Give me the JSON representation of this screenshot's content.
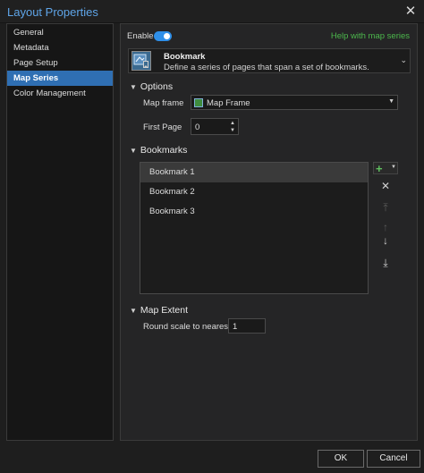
{
  "window": {
    "title": "Layout Properties",
    "close_glyph": "✕"
  },
  "nav": {
    "items": [
      {
        "label": "General",
        "active": false
      },
      {
        "label": "Metadata",
        "active": false
      },
      {
        "label": "Page Setup",
        "active": false
      },
      {
        "label": "Map Series",
        "active": true
      },
      {
        "label": "Color Management",
        "active": false
      }
    ]
  },
  "map_series": {
    "enable_label": "Enable",
    "enabled": true,
    "help_link": "Help with map series",
    "type": {
      "name": "Bookmark",
      "description": "Define a series of pages that span a set of bookmarks.",
      "icon": "bookmark-map-icon"
    },
    "options": {
      "header": "Options",
      "map_frame_label": "Map frame",
      "map_frame_value": "Map Frame",
      "first_page_label": "First Page",
      "first_page_value": "0"
    },
    "bookmarks": {
      "header": "Bookmarks",
      "items": [
        "Bookmark 1",
        "Bookmark 2",
        "Bookmark 3"
      ],
      "selected_index": 0
    },
    "map_extent": {
      "header": "Map Extent",
      "round_scale_label": "Round scale to nearest",
      "round_scale_value": "1"
    }
  },
  "footer": {
    "ok_label": "OK",
    "cancel_label": "Cancel"
  },
  "colors": {
    "accent": "#2f6fb3",
    "title": "#5fa5e8",
    "help_link": "#4cb84c",
    "toggle_on": "#2f8fe8"
  }
}
